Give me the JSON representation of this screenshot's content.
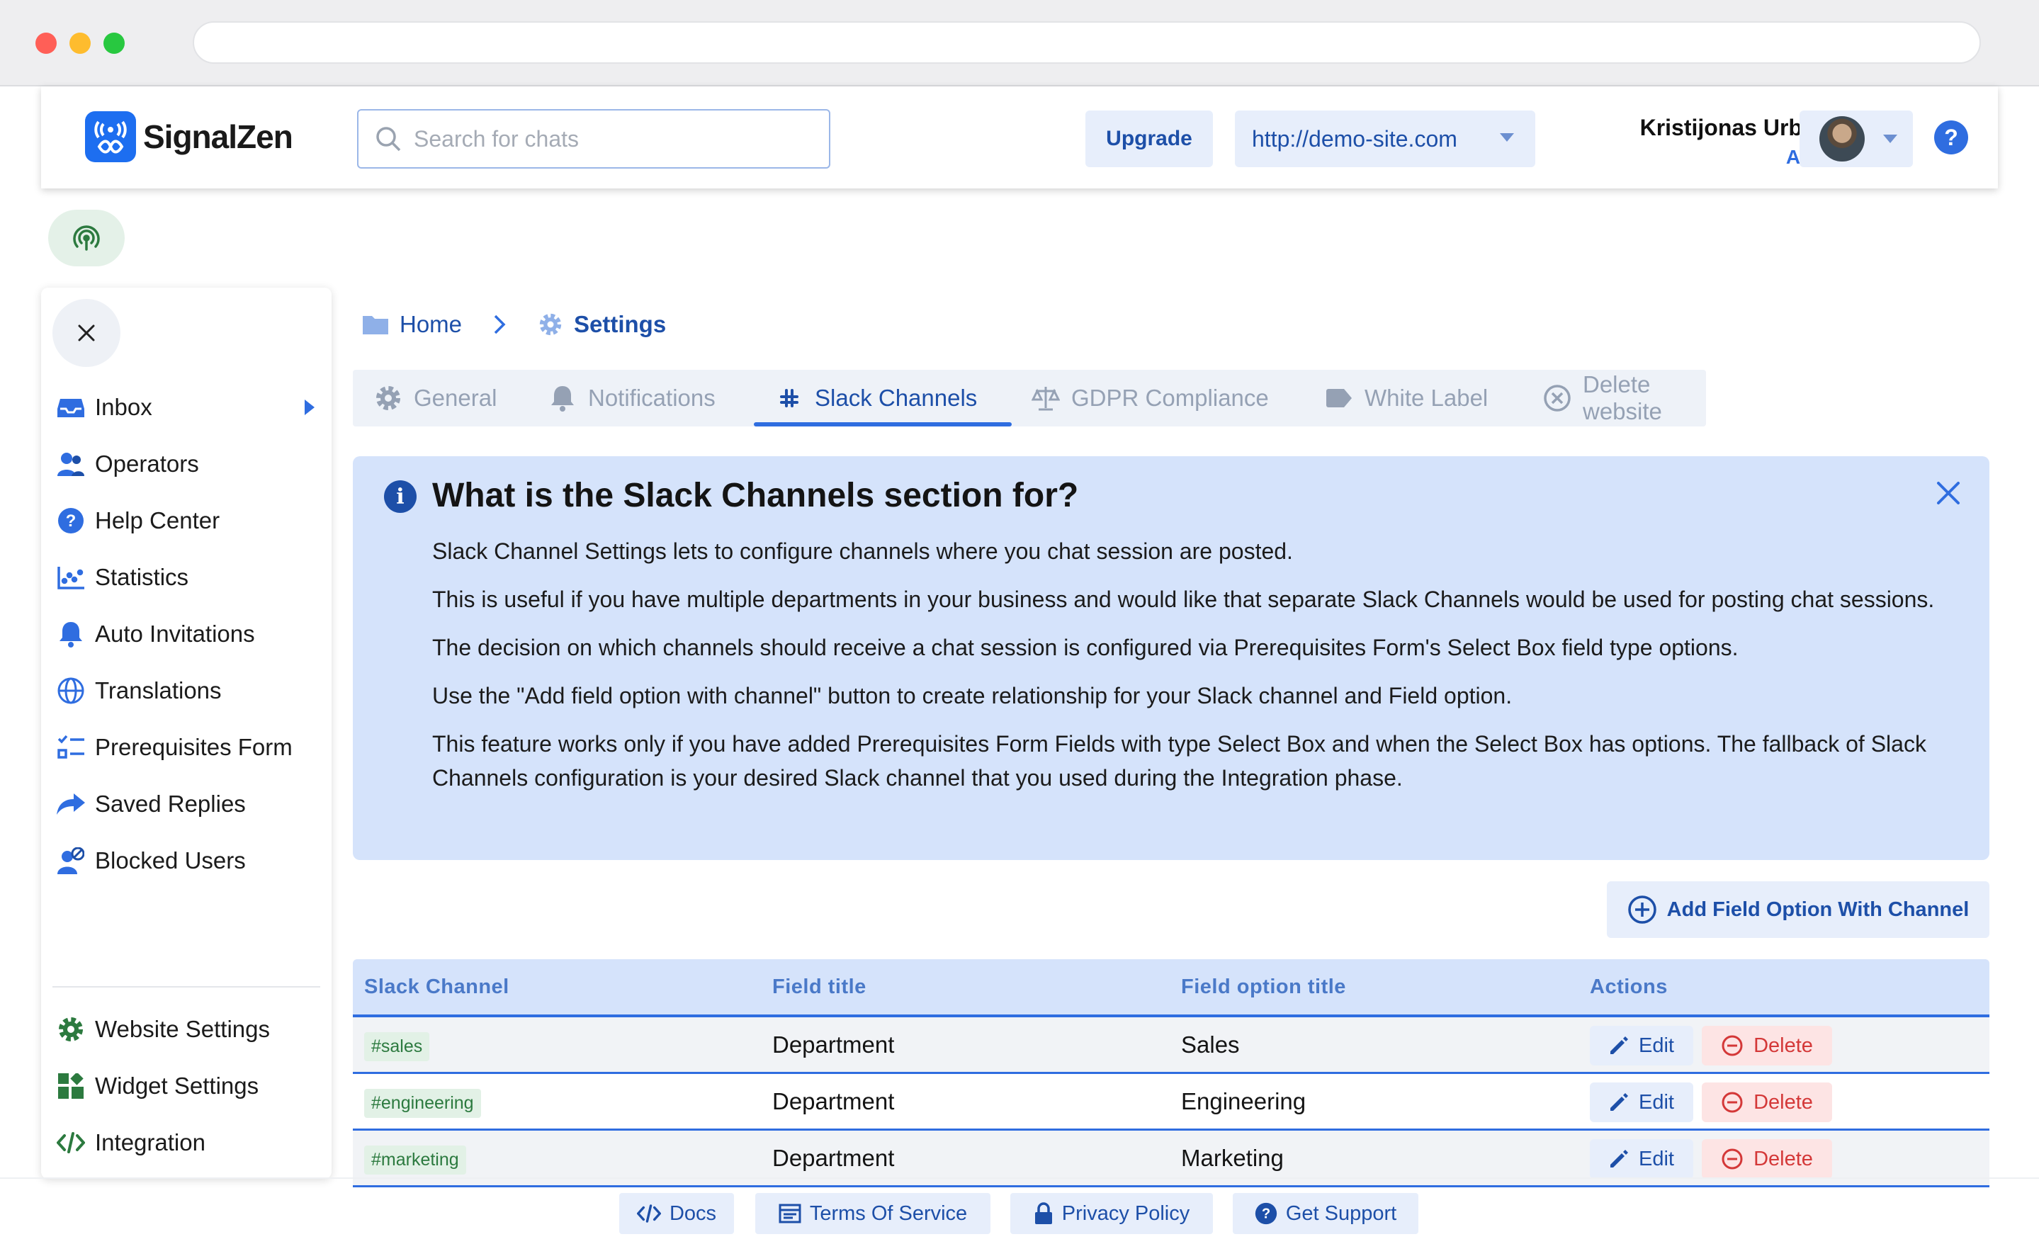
{
  "header": {
    "logo_text": "SignalZen",
    "search_placeholder": "Search for chats",
    "upgrade_label": "Upgrade",
    "site_url": "http://demo-site.com",
    "user_name": "Kristijonas Urbaitis",
    "user_role": "Admin"
  },
  "sidebar": {
    "items": [
      {
        "label": "Inbox",
        "icon": "inbox-icon"
      },
      {
        "label": "Operators",
        "icon": "operators-icon"
      },
      {
        "label": "Help Center",
        "icon": "help-center-icon"
      },
      {
        "label": "Statistics",
        "icon": "statistics-icon"
      },
      {
        "label": "Auto Invitations",
        "icon": "bell-icon"
      },
      {
        "label": "Translations",
        "icon": "globe-icon"
      },
      {
        "label": "Prerequisites Form",
        "icon": "checklist-icon"
      },
      {
        "label": "Saved Replies",
        "icon": "reply-icon"
      },
      {
        "label": "Blocked Users",
        "icon": "blocked-user-icon"
      }
    ],
    "settings_items": [
      {
        "label": "Website Settings",
        "icon": "gear-icon"
      },
      {
        "label": "Widget Settings",
        "icon": "widget-icon"
      },
      {
        "label": "Integration",
        "icon": "code-icon"
      }
    ]
  },
  "breadcrumb": {
    "home": "Home",
    "current": "Settings"
  },
  "tabs": [
    {
      "label": "General",
      "icon": "gear-icon"
    },
    {
      "label": "Notifications",
      "icon": "bell-icon"
    },
    {
      "label": "Slack Channels",
      "icon": "slack-icon",
      "active": true
    },
    {
      "label": "GDPR Compliance",
      "icon": "scale-icon"
    },
    {
      "label": "White Label",
      "icon": "tag-icon"
    },
    {
      "label": "Delete website",
      "icon": "circle-x-icon"
    }
  ],
  "info": {
    "title": "What is the Slack Channels section for?",
    "paragraphs": [
      "Slack Channel Settings lets to configure channels where you chat session are posted.",
      "This is useful if you have multiple departments in your business and would like that separate Slack Channels would be used for posting chat sessions.",
      "The decision on which channels should receive a chat session is configured via Prerequisites Form's Select Box field type options.",
      "Use the \"Add field option with channel\" button to create relationship for your Slack channel and Field option.",
      "This feature works only if you have added Prerequisites Form Fields with type Select Box and when the Select Box has options. The fallback of Slack Channels configuration is your desired Slack channel that you used during the Integration phase."
    ]
  },
  "add_button_label": "Add Field Option With Channel",
  "table": {
    "headers": [
      "Slack Channel",
      "Field title",
      "Field option title",
      "Actions"
    ],
    "rows": [
      {
        "channel": "#sales",
        "field_title": "Department",
        "option_title": "Sales"
      },
      {
        "channel": "#engineering",
        "field_title": "Department",
        "option_title": "Engineering"
      },
      {
        "channel": "#marketing",
        "field_title": "Department",
        "option_title": "Marketing"
      }
    ],
    "edit_label": "Edit",
    "delete_label": "Delete"
  },
  "footer": {
    "links": [
      "Docs",
      "Terms Of Service",
      "Privacy Policy",
      "Get Support"
    ]
  },
  "colors": {
    "accent": "#2f6de0",
    "accent_dark": "#1d4fa8",
    "light_blue": "#d5e3fb",
    "danger": "#d43838",
    "success": "#2c7a3f"
  }
}
